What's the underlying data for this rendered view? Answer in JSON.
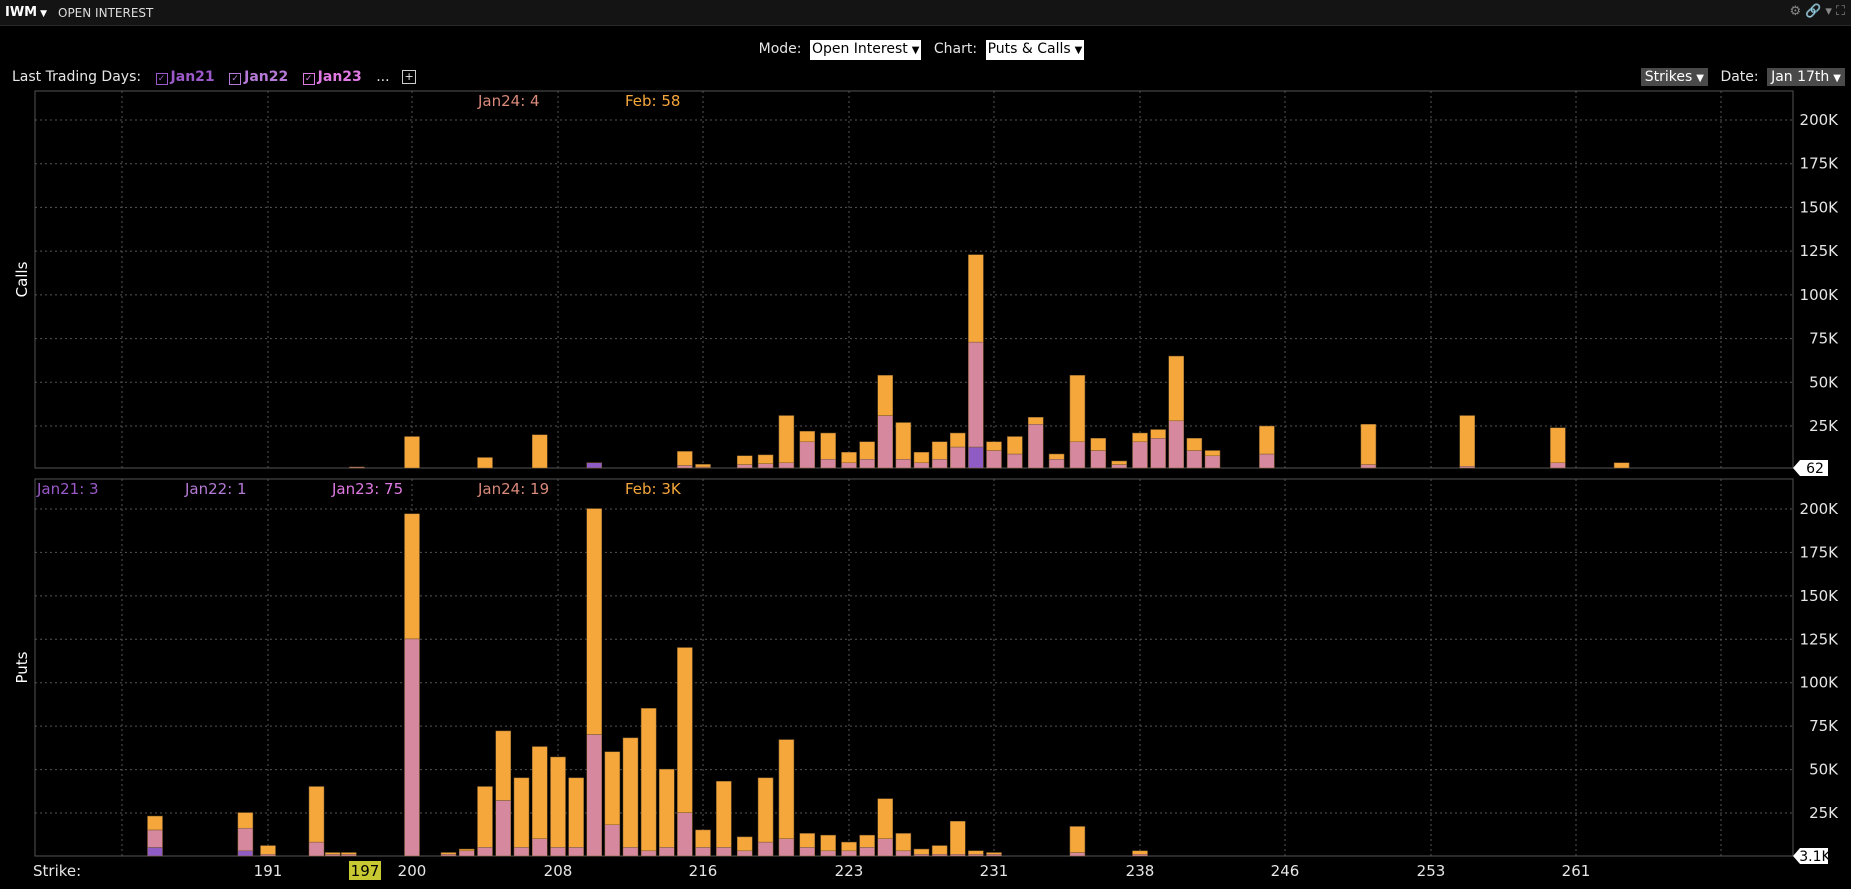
{
  "window": {
    "symbol": "IWM",
    "title": "OPEN INTEREST"
  },
  "controls": {
    "mode_label": "Mode:",
    "mode_value": "Open Interest",
    "chart_label": "Chart:",
    "chart_value": "Puts & Calls",
    "ltd_label": "Last Trading Days:",
    "ltd": [
      {
        "label": "Jan21",
        "color": "#9b59c9"
      },
      {
        "label": "Jan22",
        "color": "#b57ad6"
      },
      {
        "label": "Jan23",
        "color": "#e07ae3"
      }
    ],
    "ellipsis": "...",
    "plus": "+",
    "strikes_button": "Strikes",
    "date_label": "Date:",
    "date_value": "Jan 17th"
  },
  "chart_data": [
    {
      "type": "bar",
      "stacked": true,
      "panel": "Calls",
      "ylabel": "Calls",
      "yticks": [
        "200K",
        "175K",
        "150K",
        "125K",
        "100K",
        "75K",
        "50K",
        "25K"
      ],
      "ylim": [
        0,
        215000
      ],
      "current_value": "62",
      "legend": [
        {
          "label": "Jan24: 4",
          "color": "#d98a7a"
        },
        {
          "label": "Feb: 58",
          "color": "#f5a73c"
        }
      ],
      "strikes": [
        196.5,
        200,
        204,
        207,
        210,
        215,
        216,
        218,
        219,
        220,
        221,
        222,
        223,
        224,
        225,
        226,
        227,
        228,
        229,
        230,
        231,
        232,
        233,
        234,
        235,
        236,
        237,
        238,
        239,
        240,
        241,
        242,
        245,
        250,
        255,
        260,
        263
      ],
      "pink_values": [
        500,
        0,
        0,
        0,
        0,
        1500,
        500,
        2000,
        2500,
        3000,
        15000,
        5000,
        3000,
        5000,
        30000,
        5000,
        3000,
        5000,
        12000,
        60000,
        10000,
        8000,
        25000,
        5000,
        15000,
        10000,
        2000,
        15000,
        17000,
        27000,
        10000,
        7000,
        8000,
        2000,
        1000,
        3000,
        0
      ],
      "orange_values": [
        0,
        18000,
        6000,
        19000,
        0,
        8000,
        1500,
        5000,
        5000,
        27000,
        6000,
        15000,
        6000,
        10000,
        23000,
        21000,
        6000,
        10000,
        8000,
        50000,
        5000,
        10000,
        4000,
        3000,
        38000,
        7000,
        2000,
        5000,
        5000,
        37000,
        7000,
        3000,
        16000,
        23000,
        29000,
        20000,
        3000
      ],
      "purple_values": [
        0,
        0,
        0,
        0,
        3000,
        0,
        0,
        0,
        0,
        0,
        0,
        0,
        0,
        0,
        0,
        0,
        0,
        0,
        0,
        12000,
        0,
        0,
        0,
        0,
        0,
        0,
        0,
        0,
        0,
        0,
        0,
        0,
        0,
        0,
        0,
        0,
        0
      ]
    },
    {
      "type": "bar",
      "stacked": true,
      "panel": "Puts",
      "ylabel": "Puts",
      "yticks": [
        "200K",
        "175K",
        "150K",
        "125K",
        "100K",
        "75K",
        "50K",
        "25K"
      ],
      "ylim": [
        0,
        200000
      ],
      "current_value": "3.1K",
      "legend": [
        {
          "label": "Jan21: 3",
          "color": "#9b59c9"
        },
        {
          "label": "Jan22: 1",
          "color": "#b57ad6"
        },
        {
          "label": "Jan23: 75",
          "color": "#e07ae3"
        },
        {
          "label": "Jan24: 19",
          "color": "#d98a7a"
        },
        {
          "label": "Feb: 3K",
          "color": "#f5a73c"
        }
      ],
      "strikes": [
        186,
        190,
        191,
        194,
        195,
        196,
        200,
        202,
        203,
        204,
        205,
        206,
        207,
        208,
        209,
        210,
        211,
        212,
        213,
        214,
        215,
        216,
        217,
        218,
        219,
        220,
        221,
        222,
        223,
        224,
        225,
        226,
        227,
        228,
        229,
        230,
        231,
        235,
        238
      ],
      "pink_values": [
        10000,
        13000,
        1000,
        8000,
        1000,
        1000,
        125000,
        1000,
        3000,
        5000,
        32000,
        5000,
        10000,
        5000,
        5000,
        70000,
        18000,
        5000,
        3000,
        5000,
        25000,
        5000,
        5000,
        3000,
        8000,
        10000,
        5000,
        3000,
        3000,
        5000,
        10000,
        3000,
        1000,
        1000,
        1000,
        1000,
        1000,
        2000,
        1000
      ],
      "orange_values": [
        8000,
        9000,
        5000,
        32000,
        1000,
        1000,
        72000,
        1000,
        1000,
        35000,
        40000,
        40000,
        53000,
        52000,
        40000,
        130000,
        42000,
        63000,
        82000,
        45000,
        95000,
        10000,
        38000,
        8000,
        37000,
        57000,
        8000,
        9000,
        5000,
        7000,
        23000,
        10000,
        3000,
        5000,
        19000,
        2000,
        1000,
        15000,
        2000
      ],
      "purple_values": [
        5000,
        3000,
        0,
        0,
        0,
        0,
        0,
        0,
        0,
        0,
        0,
        0,
        0,
        0,
        0,
        0,
        0,
        0,
        0,
        0,
        0,
        0,
        0,
        0,
        0,
        0,
        0,
        0,
        0,
        0,
        0,
        0,
        0,
        0,
        0,
        0,
        0,
        0,
        0
      ]
    }
  ],
  "xaxis": {
    "label": "Strike:",
    "ticks": [
      "191",
      "200",
      "208",
      "216",
      "223",
      "231",
      "238",
      "246",
      "253",
      "261"
    ],
    "highlight": "197"
  },
  "colors": {
    "orange": "#f5a73c",
    "pink": "#d6899e",
    "purple": "#8e5cc4",
    "highlight": "#c8c832"
  }
}
